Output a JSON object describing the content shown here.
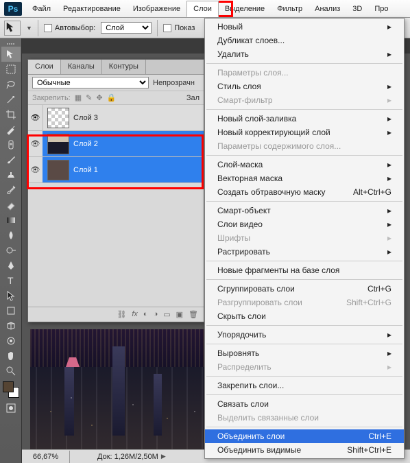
{
  "app": {
    "logo": "Ps",
    "title_truncated": "Про"
  },
  "menu": {
    "items": [
      "Файл",
      "Редактирование",
      "Изображение",
      "Слои",
      "Выделение",
      "Фильтр",
      "Анализ",
      "3D"
    ],
    "open_index": 3
  },
  "options": {
    "autoselect_label": "Автовыбор:",
    "autoselect_value": "Слой",
    "show_label_partial": "Показ"
  },
  "panels": {
    "tabs": [
      "Слои",
      "Каналы",
      "Контуры"
    ],
    "active_tab": 0,
    "blend_mode": "Обычные",
    "opacity_label_partial": "Непрозрачн",
    "lock_label": "Закрепить:",
    "fill_label_partial": "Зал",
    "layers": [
      {
        "name": "Слой 3",
        "selected": false,
        "thumb": "transparent"
      },
      {
        "name": "Слой 2",
        "selected": true,
        "thumb": "img1"
      },
      {
        "name": "Слой 1",
        "selected": true,
        "thumb": "img2"
      }
    ]
  },
  "dropdown": {
    "items": [
      {
        "label": "Новый",
        "sub": true
      },
      {
        "label": "Дубликат слоев..."
      },
      {
        "label": "Удалить",
        "sub": true
      },
      {
        "sep": true
      },
      {
        "label": "Параметры слоя...",
        "disabled": true
      },
      {
        "label": "Стиль слоя",
        "sub": true
      },
      {
        "label": "Смарт-фильтр",
        "sub": true,
        "disabled": true
      },
      {
        "sep": true
      },
      {
        "label": "Новый слой-заливка",
        "sub": true
      },
      {
        "label": "Новый корректирующий слой",
        "sub": true
      },
      {
        "label": "Параметры содержимого слоя...",
        "disabled": true
      },
      {
        "sep": true
      },
      {
        "label": "Слой-маска",
        "sub": true
      },
      {
        "label": "Векторная маска",
        "sub": true
      },
      {
        "label": "Создать обтравочную маску",
        "shortcut": "Alt+Ctrl+G"
      },
      {
        "sep": true
      },
      {
        "label": "Смарт-объект",
        "sub": true
      },
      {
        "label": "Слои видео",
        "sub": true
      },
      {
        "label": "Шрифты",
        "sub": true,
        "disabled": true
      },
      {
        "label": "Растрировать",
        "sub": true
      },
      {
        "sep": true
      },
      {
        "label": "Новые фрагменты на базе слоя"
      },
      {
        "sep": true
      },
      {
        "label": "Сгруппировать слои",
        "shortcut": "Ctrl+G"
      },
      {
        "label": "Разгруппировать слои",
        "shortcut": "Shift+Ctrl+G",
        "disabled": true
      },
      {
        "label": "Скрыть слои"
      },
      {
        "sep": true
      },
      {
        "label": "Упорядочить",
        "sub": true
      },
      {
        "sep": true
      },
      {
        "label": "Выровнять",
        "sub": true
      },
      {
        "label": "Распределить",
        "sub": true,
        "disabled": true
      },
      {
        "sep": true
      },
      {
        "label": "Закрепить слои..."
      },
      {
        "sep": true
      },
      {
        "label": "Связать слои"
      },
      {
        "label": "Выделить связанные слои",
        "disabled": true
      },
      {
        "sep": true
      },
      {
        "label": "Объединить слои",
        "shortcut": "Ctrl+E",
        "hover": true
      },
      {
        "label": "Объединить видимые",
        "shortcut": "Shift+Ctrl+E"
      }
    ]
  },
  "status": {
    "zoom": "66,67%",
    "docinfo": "Док: 1,26M/2,50M"
  }
}
